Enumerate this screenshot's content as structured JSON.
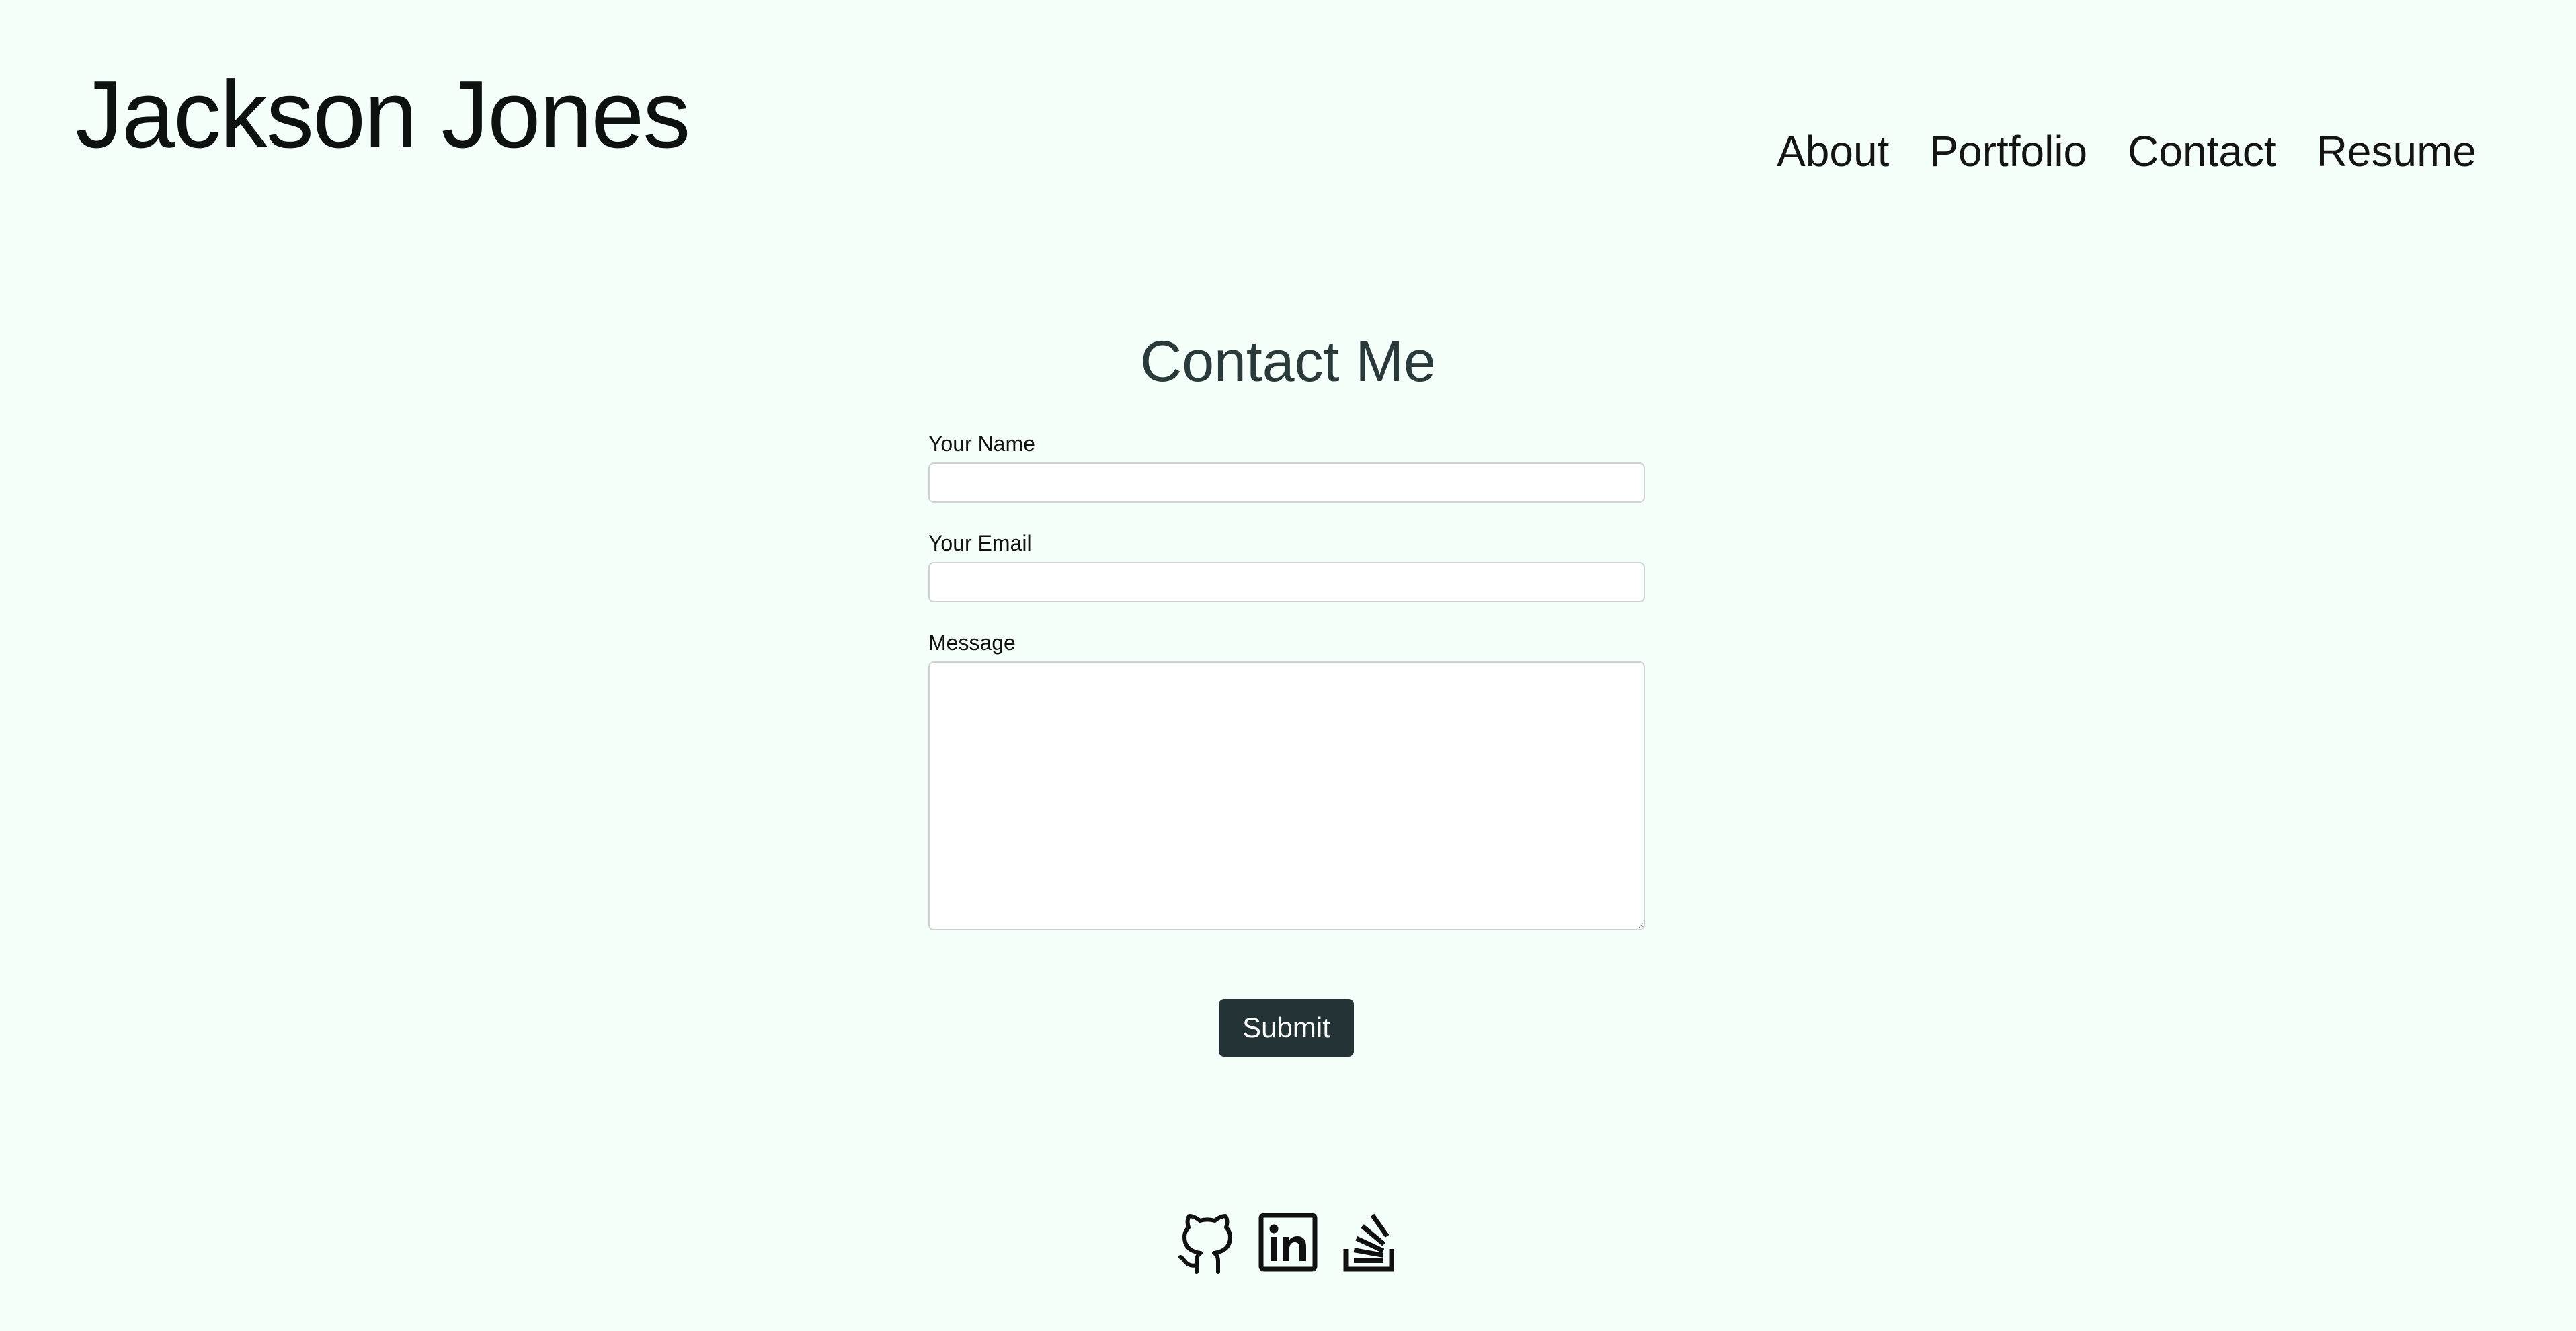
{
  "header": {
    "site_title": "Jackson Jones",
    "nav": {
      "about": "About",
      "portfolio": "Portfolio",
      "contact": "Contact",
      "resume": "Resume"
    }
  },
  "contact": {
    "title": "Contact Me",
    "name_label": "Your Name",
    "name_value": "",
    "email_label": "Your Email",
    "email_value": "",
    "message_label": "Message",
    "message_value": "",
    "submit_label": "Submit"
  },
  "footer": {
    "icons": [
      "github-icon",
      "linkedin-icon",
      "stackoverflow-icon"
    ]
  },
  "colors": {
    "background": "#f5fffa",
    "button": "#243335",
    "heading": "#2a3a3b"
  }
}
